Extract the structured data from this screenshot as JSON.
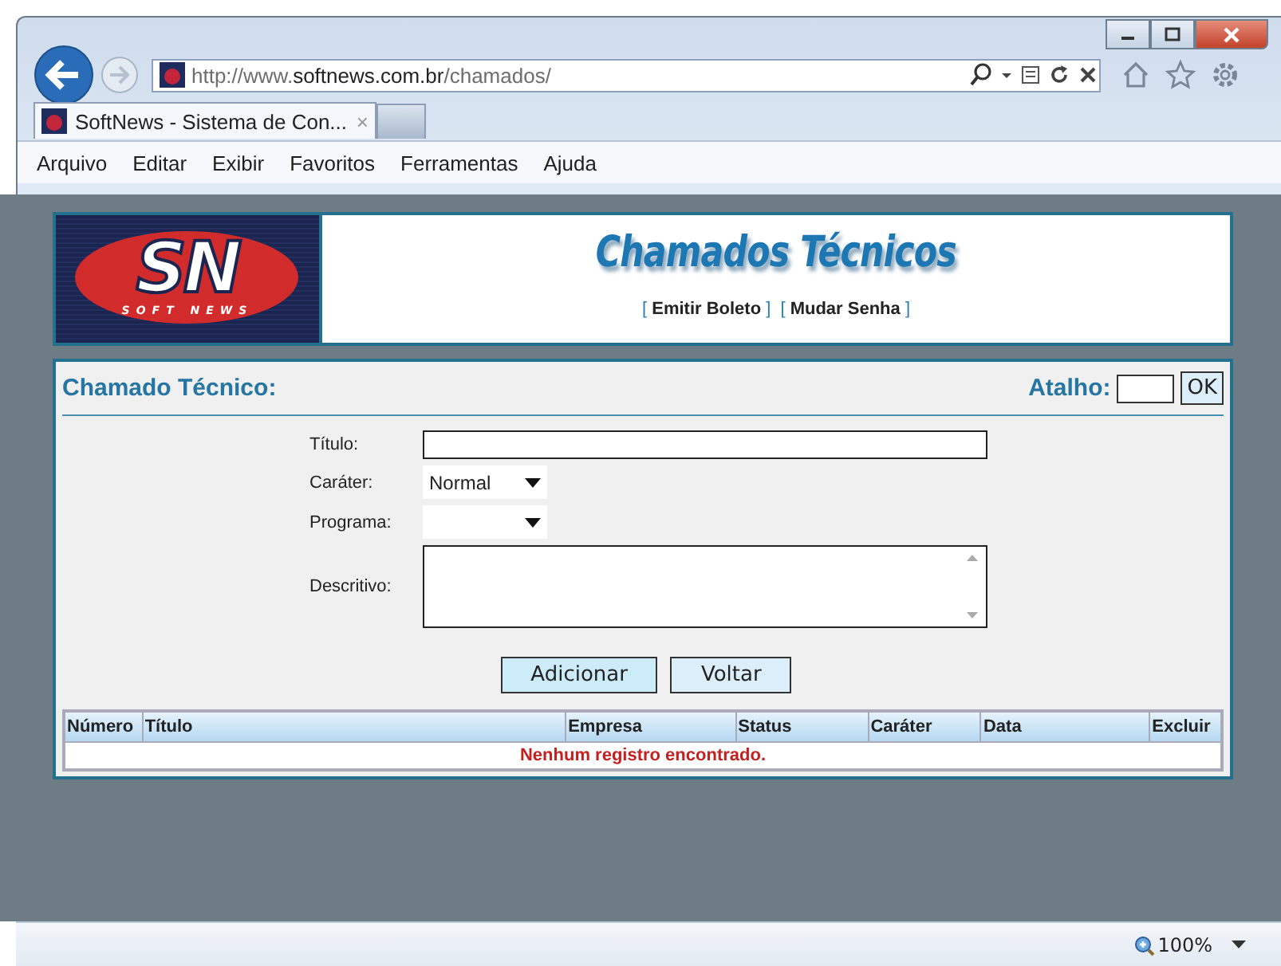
{
  "browser": {
    "address": {
      "prefix": "http://www.",
      "domain": "softnews.com.br",
      "path": "/chamados/"
    },
    "tabs": [
      {
        "label": "SoftNews - Sistema de Con...",
        "close": "×",
        "selected": true
      }
    ],
    "menu": [
      "Arquivo",
      "Editar",
      "Exibir",
      "Favoritos",
      "Ferramentas",
      "Ajuda"
    ]
  },
  "header": {
    "logo": {
      "mark": "SN",
      "tagline": "SOFT NEWS"
    },
    "title": "Chamados Técnicos",
    "links": [
      {
        "open": "[",
        "label": "Emitir Boleto",
        "close": "]"
      },
      {
        "open": "[",
        "label": "Mudar Senha",
        "close": "]"
      }
    ]
  },
  "form": {
    "title": "Chamado Técnico:",
    "shortcut": {
      "label": "Atalho:",
      "button": "OK"
    },
    "fields": [
      {
        "kind": "text",
        "label": "Título:"
      },
      {
        "kind": "select",
        "label": "Caráter:",
        "value": "Normal"
      },
      {
        "kind": "select",
        "label": "Programa:"
      },
      {
        "kind": "textarea",
        "label": "Descritivo:"
      }
    ],
    "buttons": [
      "Adicionar",
      "Voltar"
    ]
  },
  "table": {
    "columns": [
      "Número",
      "Título",
      "Empresa",
      "Status",
      "Caráter",
      "Data",
      "Excluir"
    ],
    "empty_message": "Nenhum registro encontrado."
  },
  "status_bar": {
    "zoom": "100%"
  }
}
